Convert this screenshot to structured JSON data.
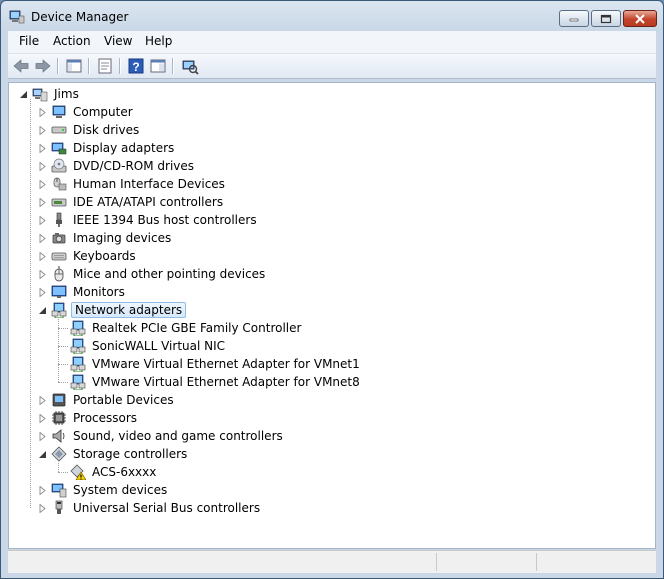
{
  "window": {
    "title": "Device Manager",
    "controls": {
      "minimize": "minimize-icon",
      "maximize": "maximize-icon",
      "close": "close-icon"
    }
  },
  "menu": [
    {
      "label": "File"
    },
    {
      "label": "Action"
    },
    {
      "label": "View"
    },
    {
      "label": "Help"
    }
  ],
  "toolbar": [
    "back-arrow-icon",
    "forward-arrow-icon",
    "show-hide-console-tree-icon",
    "properties-icon",
    "help-icon",
    "action-pane-icon",
    "scan-hardware-icon"
  ],
  "tree": {
    "root": "Jims",
    "categories": [
      {
        "label": "Computer",
        "icon": "computer-icon",
        "expanded": false
      },
      {
        "label": "Disk drives",
        "icon": "disk-drive-icon",
        "expanded": false
      },
      {
        "label": "Display adapters",
        "icon": "display-adapter-icon",
        "expanded": false
      },
      {
        "label": "DVD/CD-ROM drives",
        "icon": "dvd-drive-icon",
        "expanded": false
      },
      {
        "label": "Human Interface Devices",
        "icon": "hid-icon",
        "expanded": false
      },
      {
        "label": "IDE ATA/ATAPI controllers",
        "icon": "ide-controller-icon",
        "expanded": false
      },
      {
        "label": "IEEE 1394 Bus host controllers",
        "icon": "ieee1394-icon",
        "expanded": false
      },
      {
        "label": "Imaging devices",
        "icon": "camera-icon",
        "expanded": false
      },
      {
        "label": "Keyboards",
        "icon": "keyboard-icon",
        "expanded": false
      },
      {
        "label": "Mice and other pointing devices",
        "icon": "mouse-icon",
        "expanded": false
      },
      {
        "label": "Monitors",
        "icon": "monitor-icon",
        "expanded": false
      },
      {
        "label": "Network adapters",
        "icon": "network-adapter-icon",
        "expanded": true,
        "selected": true,
        "children": [
          {
            "label": "Realtek PCIe GBE Family Controller",
            "icon": "network-adapter-icon"
          },
          {
            "label": "SonicWALL Virtual NIC",
            "icon": "network-adapter-icon"
          },
          {
            "label": "VMware Virtual Ethernet Adapter for VMnet1",
            "icon": "network-adapter-icon"
          },
          {
            "label": "VMware Virtual Ethernet Adapter for VMnet8",
            "icon": "network-adapter-icon"
          }
        ]
      },
      {
        "label": "Portable Devices",
        "icon": "portable-device-icon",
        "expanded": false
      },
      {
        "label": "Processors",
        "icon": "processor-icon",
        "expanded": false
      },
      {
        "label": "Sound, video and game controllers",
        "icon": "speaker-icon",
        "expanded": false
      },
      {
        "label": "Storage controllers",
        "icon": "storage-controller-icon",
        "expanded": true,
        "children": [
          {
            "label": "ACS-6xxxx",
            "icon": "storage-warning-icon"
          }
        ]
      },
      {
        "label": "System devices",
        "icon": "system-device-icon",
        "expanded": false
      },
      {
        "label": "Universal Serial Bus controllers",
        "icon": "usb-icon",
        "expanded": false
      }
    ]
  },
  "colors": {
    "selection": "#d6e9fb",
    "selection_border": "#8fbce9",
    "close_button": "#c4452b"
  }
}
